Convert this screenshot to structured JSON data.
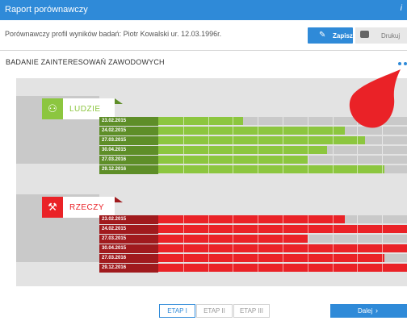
{
  "window": {
    "title": "Raport porównawczy",
    "info_icon": "info-icon"
  },
  "toolbar": {
    "description": "Porównawczy profil wyników badań: Piotr Kowalski ur. 12.03.1996r.",
    "save_label": "Zapisz",
    "save_icon": "pencil-icon",
    "print_label": "Drukuj",
    "print_icon": "printer-icon"
  },
  "section": {
    "title": "BADANIE ZAINTERESOWAŃ ZAWODOWYCH"
  },
  "colors": {
    "accent": "#2f8ad8",
    "green": "#8cc63f",
    "green_dark": "#5e8e28",
    "red": "#ea2227",
    "red_dark": "#a01a1d"
  },
  "categories": [
    {
      "label": "LUDZIE",
      "icon": "people-icon",
      "color": "#8cc63f",
      "rows": [
        {
          "date": "23.02.2015",
          "fill_fraction": 0.34
        },
        {
          "date": "24.02.2015",
          "fill_fraction": 0.75
        },
        {
          "date": "27.03.2015",
          "fill_fraction": 0.83
        },
        {
          "date": "30.04.2015",
          "fill_fraction": 0.68
        },
        {
          "date": "27.03.2016",
          "fill_fraction": 0.6
        },
        {
          "date": "29.12.2016",
          "fill_fraction": 0.91
        }
      ]
    },
    {
      "label": "RZECZY",
      "icon": "hammer-icon",
      "color": "#ea2227",
      "rows": [
        {
          "date": "23.02.2015",
          "fill_fraction": 0.75
        },
        {
          "date": "24.02.2015",
          "fill_fraction": 1.0
        },
        {
          "date": "27.03.2015",
          "fill_fraction": 0.6
        },
        {
          "date": "30.04.2015",
          "fill_fraction": 1.0
        },
        {
          "date": "27.03.2016",
          "fill_fraction": 0.91
        },
        {
          "date": "29.12.2016",
          "fill_fraction": 1.0
        }
      ]
    }
  ],
  "stages": {
    "items": [
      "ETAP I",
      "ETAP II",
      "ETAP III"
    ],
    "active_index": 0
  },
  "footer": {
    "next_label": "Dalej",
    "next_icon": "chevron-right-icon"
  }
}
